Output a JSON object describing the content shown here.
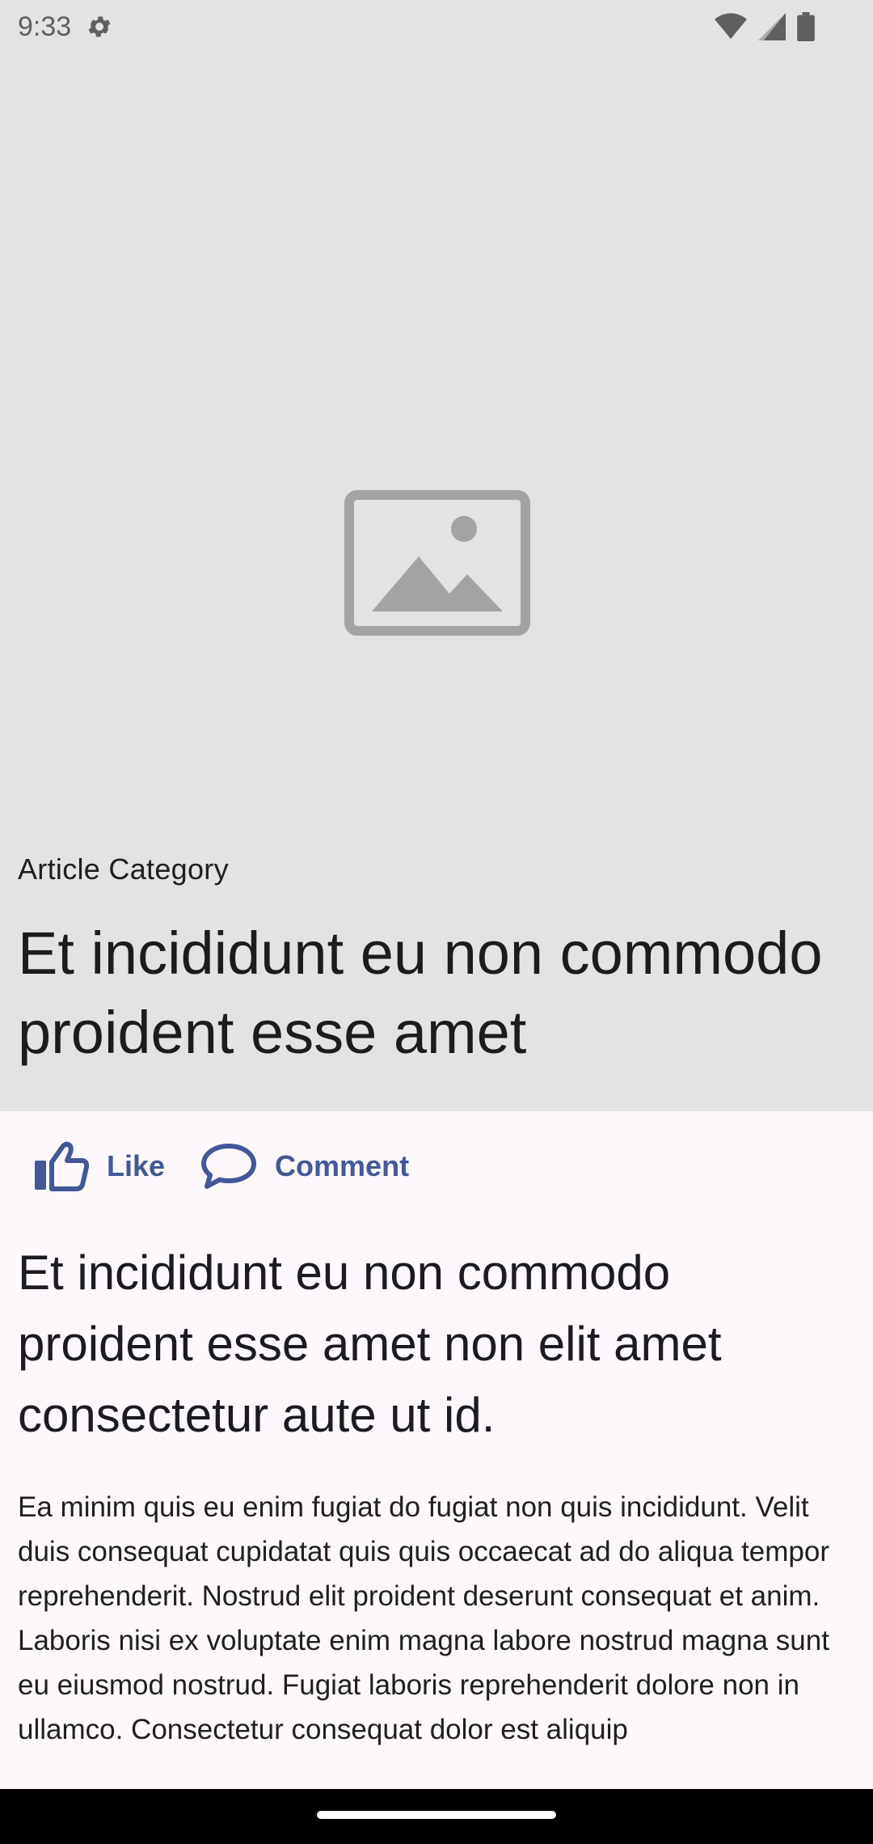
{
  "status_bar": {
    "time": "9:33",
    "icons": [
      "settings-gear-icon",
      "wifi-icon",
      "cellular-signal-icon",
      "battery-icon"
    ]
  },
  "hero": {
    "image": "image-placeholder-icon",
    "category": "Article Category",
    "title": "Et incididunt eu non commodo proident esse amet"
  },
  "actions": {
    "like_label": "Like",
    "comment_label": "Comment"
  },
  "article": {
    "subtitle": "Et incididunt eu non commodo proident esse amet non elit amet consectetur aute ut id.",
    "body": "Ea minim quis eu enim fugiat do fugiat non quis incididunt. Velit duis consequat cupidatat quis quis occaecat ad do aliqua tempor reprehenderit. Nostrud elit proident deserunt consequat et anim. Laboris nisi ex voluptate enim magna labore nostrud magna sunt eu eiusmod nostrud. Fugiat laboris reprehenderit dolore non in ullamco. Consectetur consequat dolor est aliquip"
  },
  "colors": {
    "accent": "#43579a",
    "hero_bg": "#e3e3e3",
    "page_bg": "#fcf8fc"
  }
}
